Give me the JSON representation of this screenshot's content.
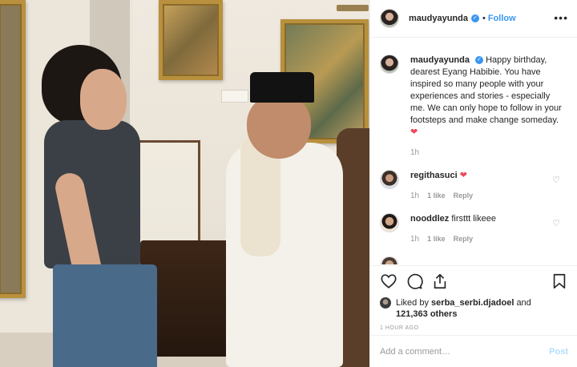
{
  "header": {
    "username": "maudyayunda",
    "separator": "•",
    "follow_label": "Follow",
    "more_label": "•••"
  },
  "caption": {
    "username": "maudyayunda",
    "text": "Happy birthday, dearest Eyang Habibie. You have inspired so many people with your experiences and stories - especially me. We can only hope to follow in your footsteps and make change someday.",
    "emoji": "❤",
    "time": "1h"
  },
  "comments": [
    {
      "username": "regithasuci",
      "text": "❤",
      "time": "1h",
      "likes": "1 like",
      "reply": "Reply"
    },
    {
      "username": "nooddlez",
      "text": "firsttt likeee",
      "time": "1h",
      "likes": "1 like",
      "reply": "Reply"
    }
  ],
  "likes": {
    "prefix": "Liked by",
    "user": "serba_serbi.djadoel",
    "and": "and",
    "count": "121,363 others"
  },
  "post_time": "1 HOUR AGO",
  "add_comment": {
    "placeholder": "Add a comment…",
    "post_label": "Post"
  },
  "icons": {
    "like": "heart-outline-icon",
    "comment": "comment-bubble-icon",
    "share": "share-icon",
    "save": "bookmark-icon",
    "verified": "verified-badge-icon"
  },
  "colors": {
    "link_blue": "#3897f0",
    "heart_red": "#ed4956",
    "muted": "#999999",
    "post_disabled": "#b2dffc"
  }
}
